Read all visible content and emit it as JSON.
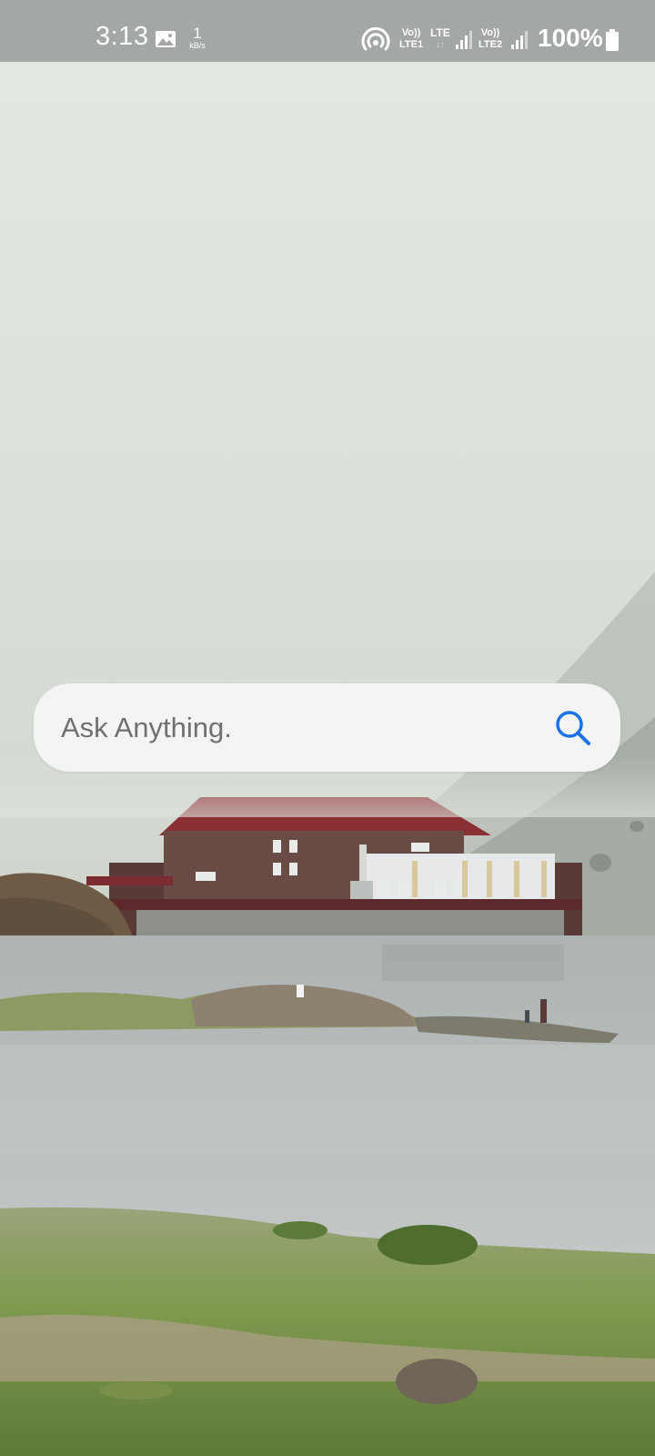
{
  "status_bar": {
    "time": "3:13",
    "net_speed_value": "1",
    "net_speed_unit": "kB/s",
    "sim1_volte_top": "Vo))",
    "sim1_volte_bottom": "LTE1",
    "lte_label": "LTE",
    "lte_arrows": "↓↑",
    "sim2_volte_top": "Vo))",
    "sim2_volte_bottom": "LTE2",
    "battery_percent": "100%",
    "icons": [
      "gallery-notification-icon",
      "hotspot-icon",
      "signal-sim1-icon",
      "signal-sim2-icon",
      "battery-icon"
    ]
  },
  "search": {
    "placeholder": "Ask Anything.",
    "value": "",
    "icon": "search-icon",
    "icon_color": "#1a73e8"
  },
  "wallpaper": {
    "subject": "lakeside-lodge-in-fog"
  }
}
